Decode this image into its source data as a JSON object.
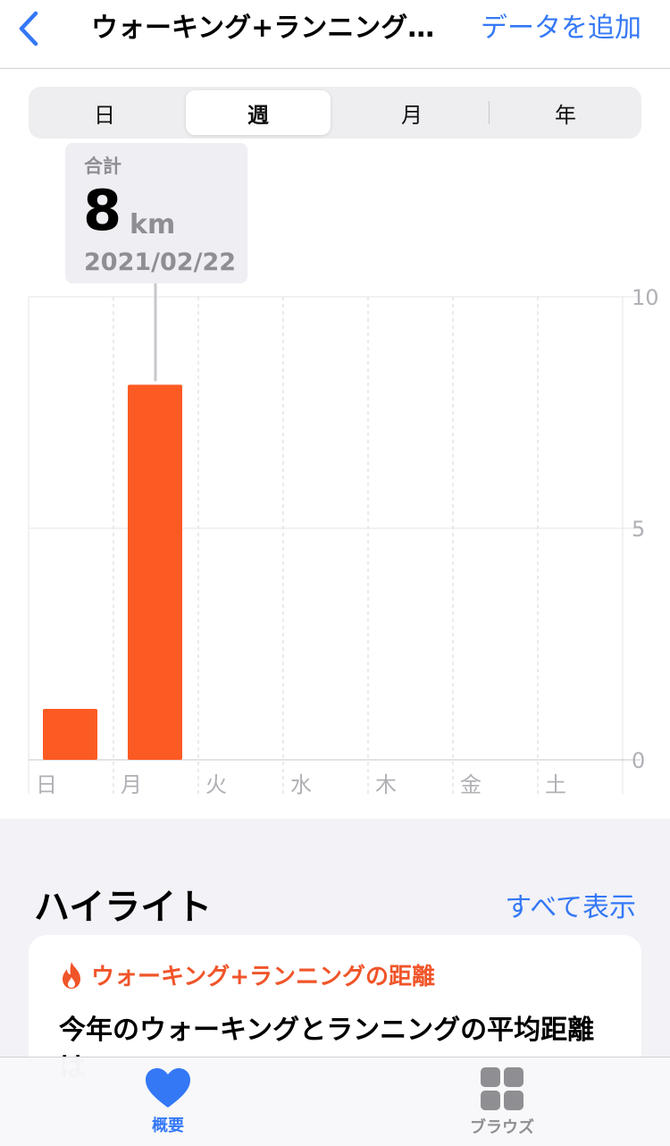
{
  "nav": {
    "back_icon": "chevron-left-icon",
    "title": "ウォーキング+ランニング…",
    "action": "データを追加"
  },
  "segments": [
    "日",
    "週",
    "月",
    "年"
  ],
  "segments_selected": "週",
  "callout": {
    "label": "合計",
    "value": "8",
    "unit": "km",
    "date": "2021/02/22"
  },
  "chart_data": {
    "type": "bar",
    "categories": [
      "日",
      "月",
      "火",
      "水",
      "木",
      "金",
      "土"
    ],
    "values": [
      1.1,
      8.1,
      0,
      0,
      0,
      0,
      0
    ],
    "ylim": [
      0,
      10
    ],
    "yticks": [
      0,
      5,
      10
    ],
    "highlighted_index": 1,
    "bar_color": "#fc5a23",
    "grid": true
  },
  "highlights": {
    "title": "ハイライト",
    "show_all": "すべて表示",
    "card": {
      "icon": "flame-icon",
      "heading": "ウォーキング+ランニングの距離",
      "body": "今年のウォーキングとランニングの平均距離は"
    }
  },
  "tabbar": {
    "tabs": [
      {
        "label": "概要",
        "icon": "heart-icon",
        "active": true
      },
      {
        "label": "ブラウズ",
        "icon": "grid-icon",
        "active": false
      }
    ]
  },
  "colors": {
    "accent": "#3478f6",
    "bar": "#fc5a23",
    "highlight_heading": "#f0552a",
    "inactive_tab": "#8e8e93"
  }
}
